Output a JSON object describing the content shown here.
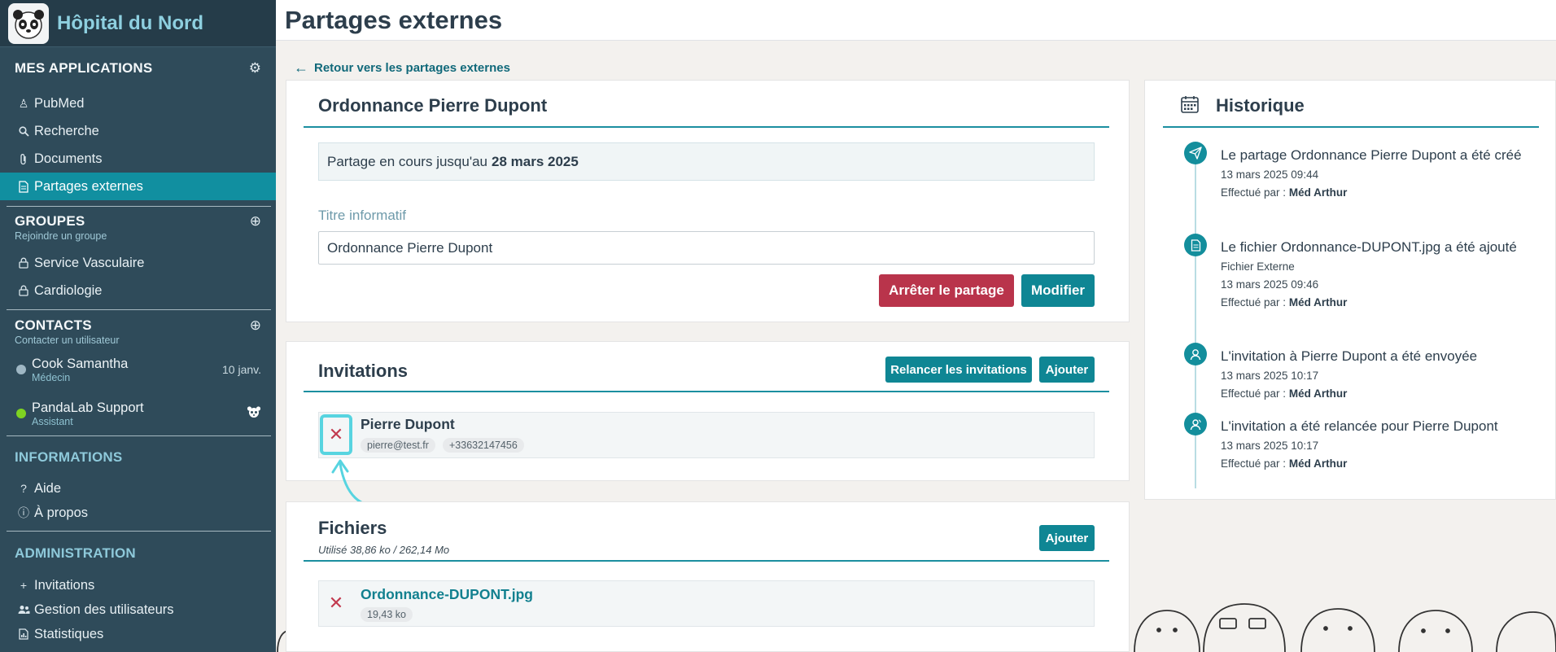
{
  "brand": {
    "name": "Hôpital du Nord"
  },
  "sidebar": {
    "apps_title": "MES APPLICATIONS",
    "apps": [
      {
        "label": "PubMed",
        "icon": "person-icon"
      },
      {
        "label": "Recherche",
        "icon": "search-icon"
      },
      {
        "label": "Documents",
        "icon": "paperclip-icon"
      },
      {
        "label": "Partages externes",
        "icon": "document-icon"
      }
    ],
    "groups_title": "GROUPES",
    "groups_sub": "Rejoindre un groupe",
    "groups": [
      {
        "label": "Service Vasculaire",
        "icon": "lock-icon"
      },
      {
        "label": "Cardiologie",
        "icon": "lock-icon"
      }
    ],
    "contacts_title": "CONTACTS",
    "contacts_sub": "Contacter un utilisateur",
    "contacts": [
      {
        "name": "Cook Samantha",
        "role": "Médecin",
        "date": "10 janv.",
        "status_color": "#9fb7c4"
      },
      {
        "name": "PandaLab Support",
        "role": "Assistant",
        "date": "",
        "status_color": "#7ed321"
      }
    ],
    "info_title": "INFORMATIONS",
    "info": [
      {
        "label": "Aide",
        "icon": "question-icon"
      },
      {
        "label": "À propos",
        "icon": "info-icon"
      }
    ],
    "admin_title": "ADMINISTRATION",
    "admin": [
      {
        "label": "Invitations",
        "icon": "plus-icon"
      },
      {
        "label": "Gestion des utilisateurs",
        "icon": "users-icon"
      },
      {
        "label": "Statistiques",
        "icon": "chart-icon"
      }
    ]
  },
  "page": {
    "title": "Partages externes",
    "back_label": "Retour vers les partages externes"
  },
  "share": {
    "title": "Ordonnance Pierre Dupont",
    "status_prefix": "Partage en cours jusqu'au",
    "status_date": "28 mars 2025",
    "field_label": "Titre informatif",
    "field_value": "Ordonnance Pierre Dupont",
    "stop_label": "Arrêter le partage",
    "edit_label": "Modifier"
  },
  "invitations": {
    "title": "Invitations",
    "resend_label": "Relancer les invitations",
    "add_label": "Ajouter",
    "items": [
      {
        "name": "Pierre Dupont",
        "email": "pierre@test.fr",
        "phone": "+33632147456"
      }
    ]
  },
  "files": {
    "title": "Fichiers",
    "usage": "Utilisé 38,86 ko / 262,14 Mo",
    "add_label": "Ajouter",
    "items": [
      {
        "name": "Ordonnance-DUPONT.jpg",
        "size": "19,43 ko"
      }
    ]
  },
  "history": {
    "title": "Historique",
    "by_label": "Effectué par :",
    "items": [
      {
        "text": "Le partage Ordonnance Pierre Dupont a été créé",
        "extra": "",
        "date": "13 mars 2025 09:44",
        "author": "Méd Arthur",
        "icon": "send-icon"
      },
      {
        "text": "Le fichier Ordonnance-DUPONT.jpg a été ajouté",
        "extra": "Fichier Externe",
        "date": "13 mars 2025 09:46",
        "author": "Méd Arthur",
        "icon": "file-icon"
      },
      {
        "text": "L'invitation à Pierre Dupont a été envoyée",
        "extra": "",
        "date": "13 mars 2025 10:17",
        "author": "Méd Arthur",
        "icon": "user-icon"
      },
      {
        "text": "L'invitation a été relancée pour Pierre Dupont",
        "extra": "",
        "date": "13 mars 2025 10:17",
        "author": "Méd Arthur",
        "icon": "user-refresh-icon"
      }
    ]
  }
}
